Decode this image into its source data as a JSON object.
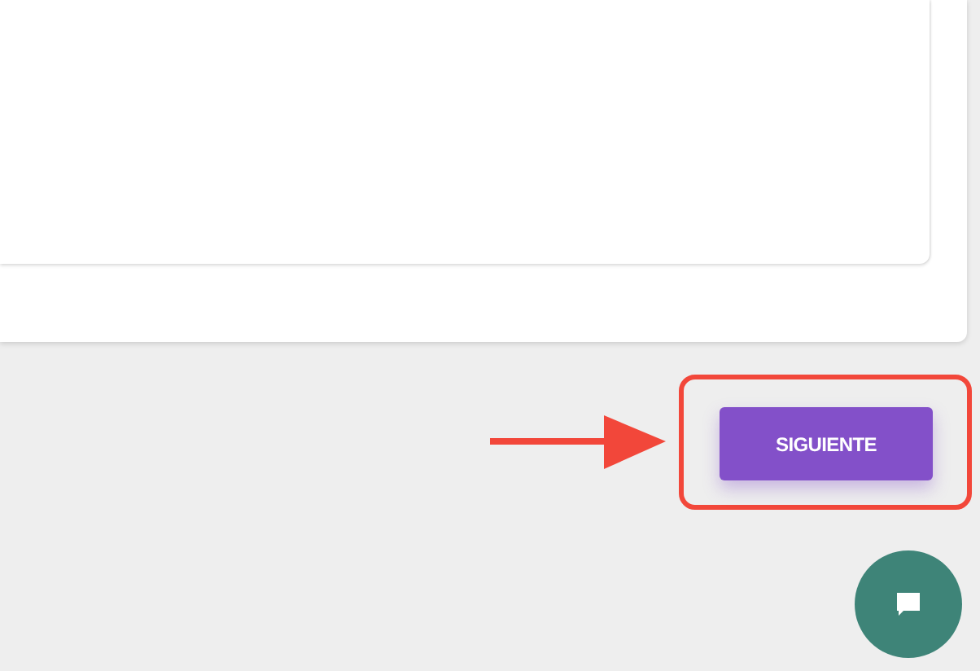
{
  "next_button": {
    "label": "SIGUIENTE"
  }
}
